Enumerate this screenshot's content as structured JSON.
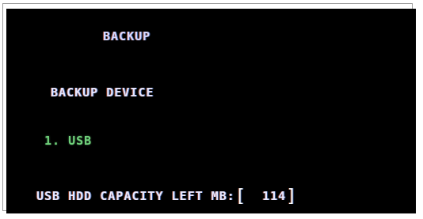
{
  "screen": {
    "title": "BACKUP",
    "section_label": "BACKUP DEVICE",
    "device_item": "1. USB",
    "capacity": {
      "label": "USB HDD CAPACITY LEFT MB:",
      "open_bracket": "[",
      "value": "114",
      "close_bracket": "]"
    }
  },
  "colors": {
    "background": "#000000",
    "text": "#e6e6ff",
    "selected_item": "#6fd07a"
  }
}
